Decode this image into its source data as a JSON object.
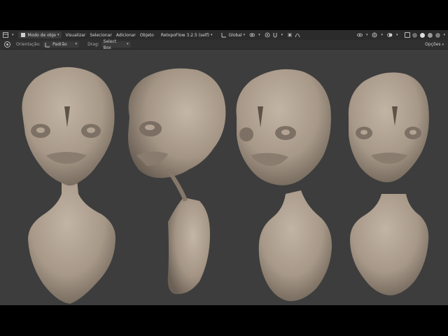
{
  "header": {
    "mode": "Modo de obje",
    "menus": [
      "Visualizar",
      "Selecionar",
      "Adicionar",
      "Objeto"
    ],
    "addon": "RetopoFlow 3.2.5 (self)",
    "transform_orientation": "Global"
  },
  "toolbar": {
    "orientation_label": "Orientação:",
    "orientation_value": "Padrão",
    "drag_label": "Drag:",
    "drag_value": "Select Box",
    "options_label": "Opções"
  },
  "colors": {
    "viewport_bg": "#3d3d3d",
    "header_bg": "#2b2b2b",
    "clay": "#a9998a"
  },
  "viewport": {
    "objects": [
      "alien-bust-front",
      "alien-bust-side",
      "alien-bust-three-quarter",
      "alien-bust-front-right"
    ]
  }
}
